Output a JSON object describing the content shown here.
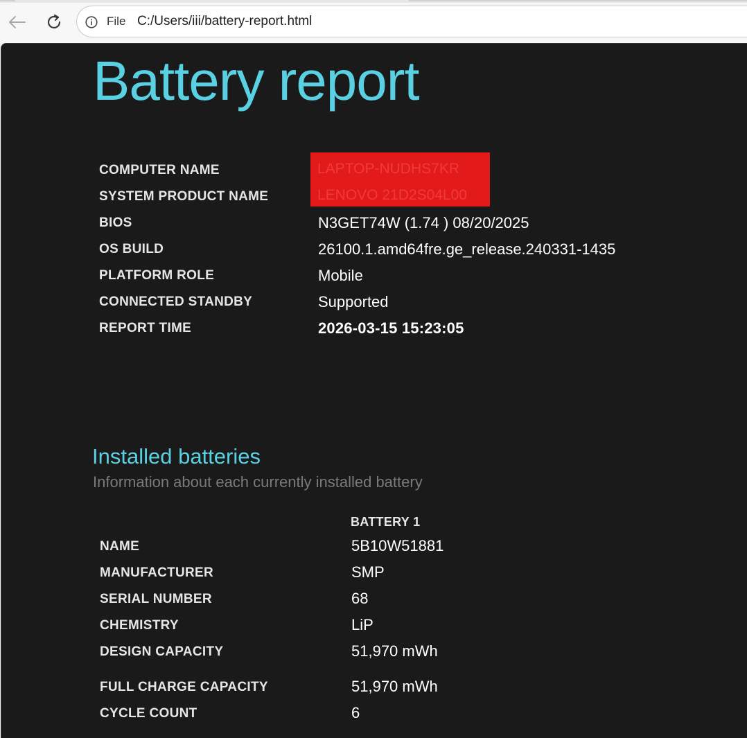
{
  "browser": {
    "back_icon": "back-arrow-icon",
    "reload_icon": "reload-icon",
    "info_icon": "info-circle-icon",
    "address_scheme_label": "File",
    "url": "C:/Users/iii/battery-report.html"
  },
  "report": {
    "title": "Battery report",
    "system_info": [
      {
        "label": "COMPUTER NAME",
        "value": "LAPTOP-NUDHS7KR",
        "redacted": true
      },
      {
        "label": "SYSTEM PRODUCT NAME",
        "value": "LENOVO 21D2S04L00",
        "redacted": true
      },
      {
        "label": "BIOS",
        "value": "N3GET74W (1.74 ) 08/20/2025"
      },
      {
        "label": "OS BUILD",
        "value": "26100.1.amd64fre.ge_release.240331-1435"
      },
      {
        "label": "PLATFORM ROLE",
        "value": "Mobile"
      },
      {
        "label": "CONNECTED STANDBY",
        "value": "Supported"
      },
      {
        "label": "REPORT TIME",
        "value": "2026-03-15  15:23:05"
      }
    ]
  },
  "installed_batteries": {
    "title": "Installed batteries",
    "subtitle": "Information about each currently installed battery",
    "column_header": "BATTERY 1",
    "rows": [
      {
        "label": "NAME",
        "value": "5B10W51881"
      },
      {
        "label": "MANUFACTURER",
        "value": "SMP"
      },
      {
        "label": "SERIAL NUMBER",
        "value": "68"
      },
      {
        "label": "CHEMISTRY",
        "value": "LiP"
      },
      {
        "label": "DESIGN CAPACITY",
        "value": "51,970 mWh"
      },
      {
        "label": "FULL CHARGE CAPACITY",
        "value": "51,970 mWh"
      },
      {
        "label": "CYCLE COUNT",
        "value": "6"
      }
    ]
  },
  "colors": {
    "accent": "#5ad0e3",
    "background": "#1a1a1a",
    "redaction": "#e21a1a"
  }
}
